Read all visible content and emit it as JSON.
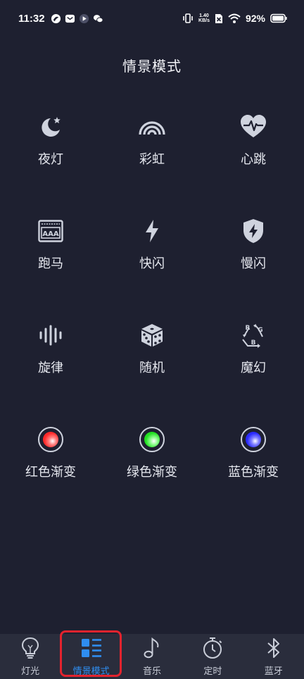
{
  "status_bar": {
    "time": "11:32",
    "speed_value": "1.40",
    "speed_unit": "KB/s",
    "battery": "92%",
    "icons": [
      "app-notification-icon",
      "mail-icon",
      "play-icon",
      "wechat-icon",
      "vibrate-icon",
      "sim-x-icon",
      "wifi-icon",
      "battery-icon"
    ]
  },
  "page": {
    "title": "情景模式"
  },
  "modes": [
    {
      "label": "夜灯",
      "icon": "moon-star-icon"
    },
    {
      "label": "彩虹",
      "icon": "rainbow-icon"
    },
    {
      "label": "心跳",
      "icon": "heartbeat-icon"
    },
    {
      "label": "跑马",
      "icon": "marquee-aaa-icon"
    },
    {
      "label": "快闪",
      "icon": "lightning-icon"
    },
    {
      "label": "慢闪",
      "icon": "shield-bolt-icon"
    },
    {
      "label": "旋律",
      "icon": "sound-wave-icon"
    },
    {
      "label": "随机",
      "icon": "dice-icon"
    },
    {
      "label": "魔幻",
      "icon": "rgb-cycle-icon"
    },
    {
      "label": "红色渐变",
      "icon": "red-gradient-icon",
      "color": "#ff2a2a"
    },
    {
      "label": "绿色渐变",
      "icon": "green-gradient-icon",
      "color": "#22e022"
    },
    {
      "label": "蓝色渐变",
      "icon": "blue-gradient-icon",
      "color": "#2a2aff"
    }
  ],
  "nav": [
    {
      "label": "灯光",
      "icon": "bulb-icon"
    },
    {
      "label": "情景模式",
      "icon": "scene-list-icon",
      "active": true
    },
    {
      "label": "音乐",
      "icon": "music-note-icon"
    },
    {
      "label": "定时",
      "icon": "stopwatch-icon"
    },
    {
      "label": "蓝牙",
      "icon": "bluetooth-icon"
    }
  ],
  "colors": {
    "background": "#1e2030",
    "nav_background": "#2a2d3c",
    "active": "#2f8df0",
    "highlight_border": "#e3232e",
    "icon": "#cfd3de"
  }
}
